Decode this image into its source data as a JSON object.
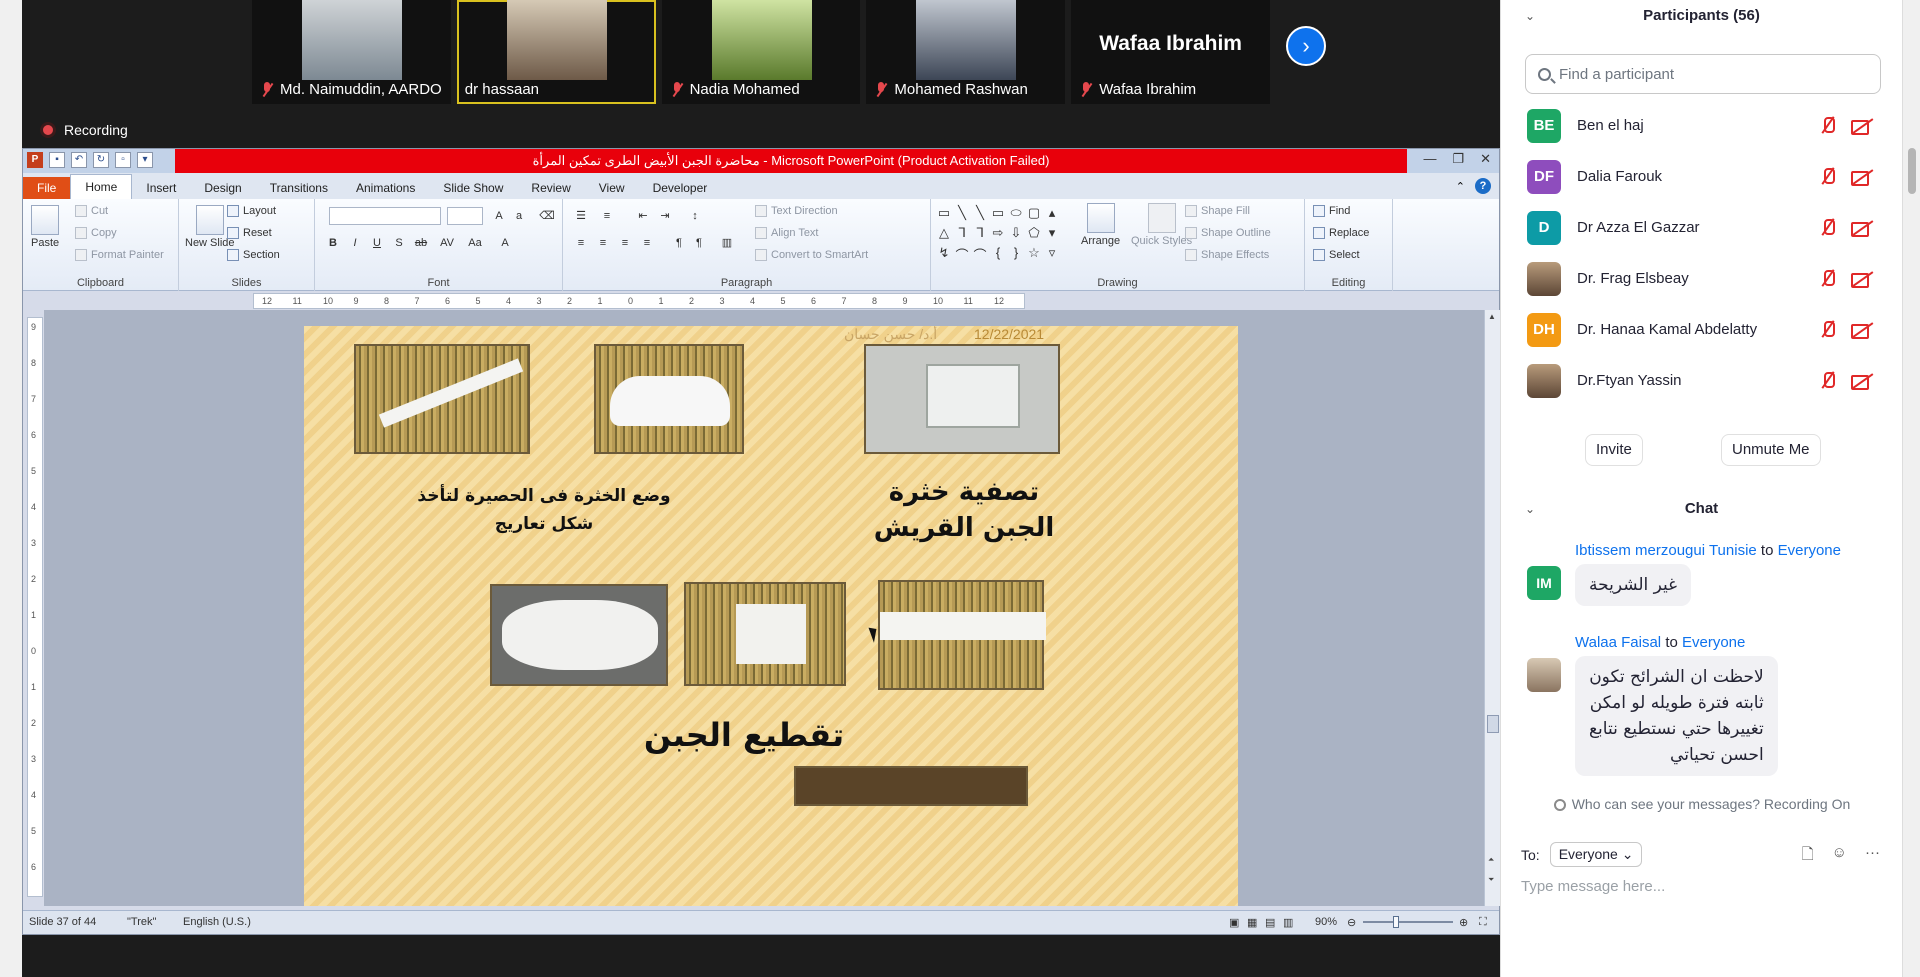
{
  "gallery": {
    "tiles": [
      {
        "name": "Md. Naimuddin, AARDO",
        "muted": true,
        "active": false
      },
      {
        "name": "dr hassaan",
        "muted": false,
        "active": true
      },
      {
        "name": "Nadia Mohamed",
        "muted": true,
        "active": false
      },
      {
        "name": "Mohamed Rashwan",
        "muted": true,
        "active": false
      },
      {
        "name": "Wafaa Ibrahim",
        "muted": true,
        "active": false,
        "display_name": "Wafaa Ibrahim"
      }
    ],
    "next_glyph": "›"
  },
  "recording_label": "Recording",
  "powerpoint": {
    "title": "محاضرة الجبن الأبيض الطرى تمكين المرأة - Microsoft PowerPoint (Product Activation Failed)",
    "tabs": [
      "File",
      "Home",
      "Insert",
      "Design",
      "Transitions",
      "Animations",
      "Slide Show",
      "Review",
      "View",
      "Developer"
    ],
    "active_tab": "Home",
    "ribbon": {
      "clipboard": {
        "label": "Clipboard",
        "paste": "Paste",
        "cut": "Cut",
        "copy": "Copy",
        "format_painter": "Format Painter"
      },
      "slides": {
        "label": "Slides",
        "new_slide": "New Slide",
        "layout": "Layout",
        "reset": "Reset",
        "section": "Section"
      },
      "font": {
        "label": "Font"
      },
      "paragraph": {
        "label": "Paragraph",
        "text_direction": "Text Direction",
        "align_text": "Align Text",
        "convert_smartart": "Convert to SmartArt"
      },
      "drawing": {
        "label": "Drawing",
        "arrange": "Arrange",
        "quick_styles": "Quick Styles",
        "shape_fill": "Shape Fill",
        "shape_outline": "Shape Outline",
        "shape_effects": "Shape Effects"
      },
      "editing": {
        "label": "Editing",
        "find": "Find",
        "replace": "Replace",
        "select": "Select"
      }
    },
    "h_ruler_ticks": [
      "12",
      "11",
      "10",
      "9",
      "8",
      "7",
      "6",
      "5",
      "4",
      "3",
      "2",
      "1",
      "0",
      "1",
      "2",
      "3",
      "4",
      "5",
      "6",
      "7",
      "8",
      "9",
      "10",
      "11",
      "12"
    ],
    "v_ruler_ticks": [
      "9",
      "8",
      "7",
      "6",
      "5",
      "4",
      "3",
      "2",
      "1",
      "0",
      "1",
      "2",
      "3",
      "4",
      "5",
      "6"
    ],
    "slide": {
      "date": "12/22/2021",
      "author": "أ.د/ حسن حسان",
      "caption_mat": "وضع الخثرة فى الحصيرة لتأخذ\nشكل تعاريج",
      "caption_filter": "تصفية خثرة\nالجبن القريش",
      "caption_cut": "تقطيع الجبن"
    },
    "status": {
      "slide": "Slide 37 of 44",
      "theme": "\"Trek\"",
      "language": "English (U.S.)",
      "zoom": "90%"
    }
  },
  "participants": {
    "header": "Participants (56)",
    "search_placeholder": "Find a participant",
    "items": [
      {
        "initials": "BE",
        "name": "Ben el haj",
        "color": "#1ea765",
        "photo": false
      },
      {
        "initials": "DF",
        "name": "Dalia Farouk",
        "color": "#8e4dbd",
        "photo": false
      },
      {
        "initials": "D",
        "name": "Dr Azza El Gazzar",
        "color": "#0d9ba6",
        "photo": false
      },
      {
        "initials": "",
        "name": "Dr. Frag Elsbeay",
        "color": "#7a5a44",
        "photo": true
      },
      {
        "initials": "DH",
        "name": "Dr. Hanaa Kamal Abdelatty",
        "color": "#f39a13",
        "photo": false
      },
      {
        "initials": "",
        "name": "Dr.Ftyan Yassin",
        "color": "#5e4a3c",
        "photo": true
      }
    ],
    "invite": "Invite",
    "unmute": "Unmute Me"
  },
  "chat": {
    "header": "Chat",
    "messages": [
      {
        "sender": "Ibtissem merzougui Tunisie",
        "to_word": "to",
        "target": "Everyone",
        "initials": "IM",
        "color": "#1ea765",
        "text": "غير الشريحة"
      },
      {
        "sender": "Walaa Faisal",
        "to_word": "to",
        "target": "Everyone",
        "initials": "",
        "color": "#9e8a74",
        "text": "لاحظت ان الشرائح تكون\nثابته فترة طويله  لو امكن\nتغييرها حتي نستطيع نتابع\nاحسن تحياتي"
      }
    ],
    "privacy": "Who can see your messages? Recording On",
    "to_label": "To:",
    "to_value": "Everyone",
    "input_placeholder": "Type message here..."
  }
}
